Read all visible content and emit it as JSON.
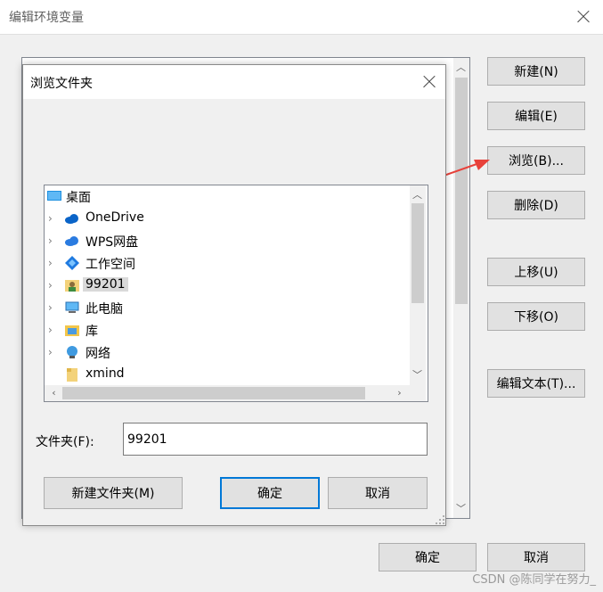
{
  "window": {
    "title": "编辑环境变量"
  },
  "side_buttons": {
    "new": "新建(N)",
    "edit": "编辑(E)",
    "browse": "浏览(B)...",
    "delete": "删除(D)",
    "move_up": "上移(U)",
    "move_down": "下移(O)",
    "edit_text": "编辑文本(T)..."
  },
  "footer": {
    "ok": "确定",
    "cancel": "取消"
  },
  "browse_dialog": {
    "title": "浏览文件夹",
    "tree": [
      {
        "label": "桌面",
        "icon": "desktop-icon"
      },
      {
        "label": "OneDrive",
        "icon": "cloud-icon"
      },
      {
        "label": "WPS网盘",
        "icon": "wps-cloud-icon"
      },
      {
        "label": "工作空间",
        "icon": "workspace-icon"
      },
      {
        "label": "99201",
        "icon": "user-folder-icon"
      },
      {
        "label": "此电脑",
        "icon": "computer-icon"
      },
      {
        "label": "库",
        "icon": "library-icon"
      },
      {
        "label": "网络",
        "icon": "network-icon"
      },
      {
        "label": "xmind",
        "icon": "folder-icon"
      }
    ],
    "folder_label": "文件夹(F):",
    "folder_value": "99201",
    "new_folder": "新建文件夹(M)",
    "ok": "确定",
    "cancel": "取消"
  },
  "watermark": "CSDN @陈同学在努力_",
  "colors": {
    "accent": "#0078d7",
    "arrow": "#e8413a"
  }
}
